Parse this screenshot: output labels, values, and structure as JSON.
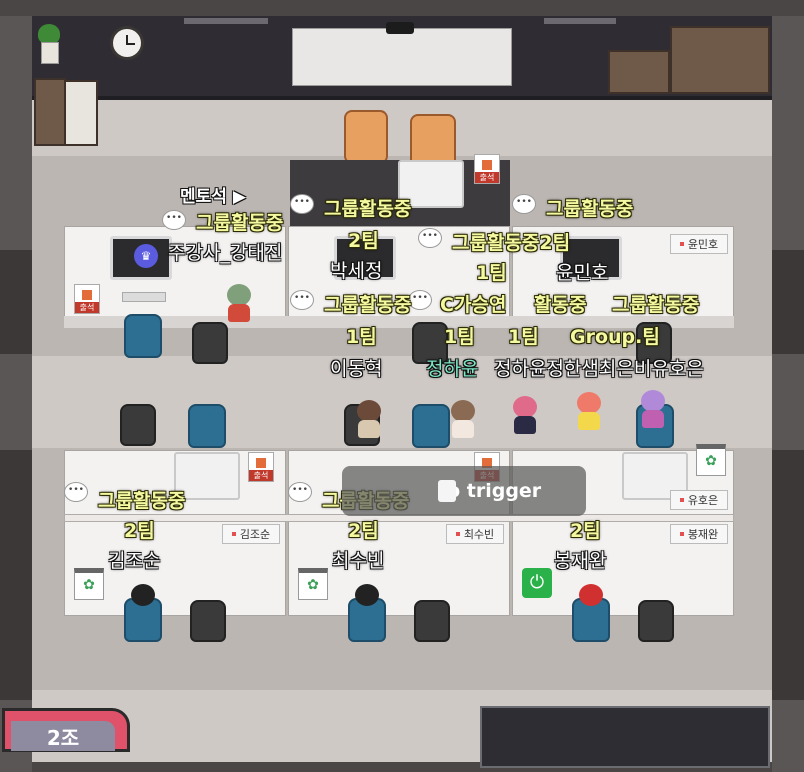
{
  "room": {
    "team_badge": "2조",
    "mentor_seat": "멘토석 ▶",
    "trigger_hint": "to trigger"
  },
  "status_labels": {
    "group_activity": "그룹활동중",
    "group_activity_2team": "그룹활동중2팀",
    "team1": "1팀",
    "team2": "2팀",
    "group_team": "Group.팀",
    "overlap_1": "그룹활동중",
    "overlap_2": "C가승연",
    "overlap_3": "활동중"
  },
  "players": [
    {
      "name": "주강사_강태진",
      "status": "그룹활동중"
    },
    {
      "name": "박세정",
      "status": "그룹활동중",
      "team": "2팀"
    },
    {
      "name": "윤민호",
      "status": "그룹활동중2팀",
      "team": "1팀"
    },
    {
      "name": "이동혁",
      "status": "그룹활동중",
      "team": "1팀"
    },
    {
      "name": "정하윤",
      "team": "1팀"
    },
    {
      "name": "정한샘",
      "team": "1팀"
    },
    {
      "name": "최은비",
      "status": "그룹활동중"
    },
    {
      "name": "유호은",
      "status": "Group.팀"
    },
    {
      "name": "김조순",
      "status": "그룹활동중",
      "team": "2팀"
    },
    {
      "name": "최수빈",
      "status": "그룹활동중",
      "team": "2팀"
    },
    {
      "name": "봉재완",
      "team": "2팀"
    }
  ],
  "nameplates": {
    "yunminho": "윤민호",
    "yuhoeun": "유호은",
    "kimjosun": "김조순",
    "choisubin": "최수빈",
    "bongjaewan": "봉재완"
  },
  "overlapped_names": "정하윤정한샘최은비유호은",
  "attendance_label": "출석",
  "chat_bubble_glyph": "•••",
  "colors": {
    "status_text": "#f4f8a0",
    "name_text": "#ffffff",
    "mint_name": "#7de8c6",
    "team_badge": "#e0516a"
  }
}
